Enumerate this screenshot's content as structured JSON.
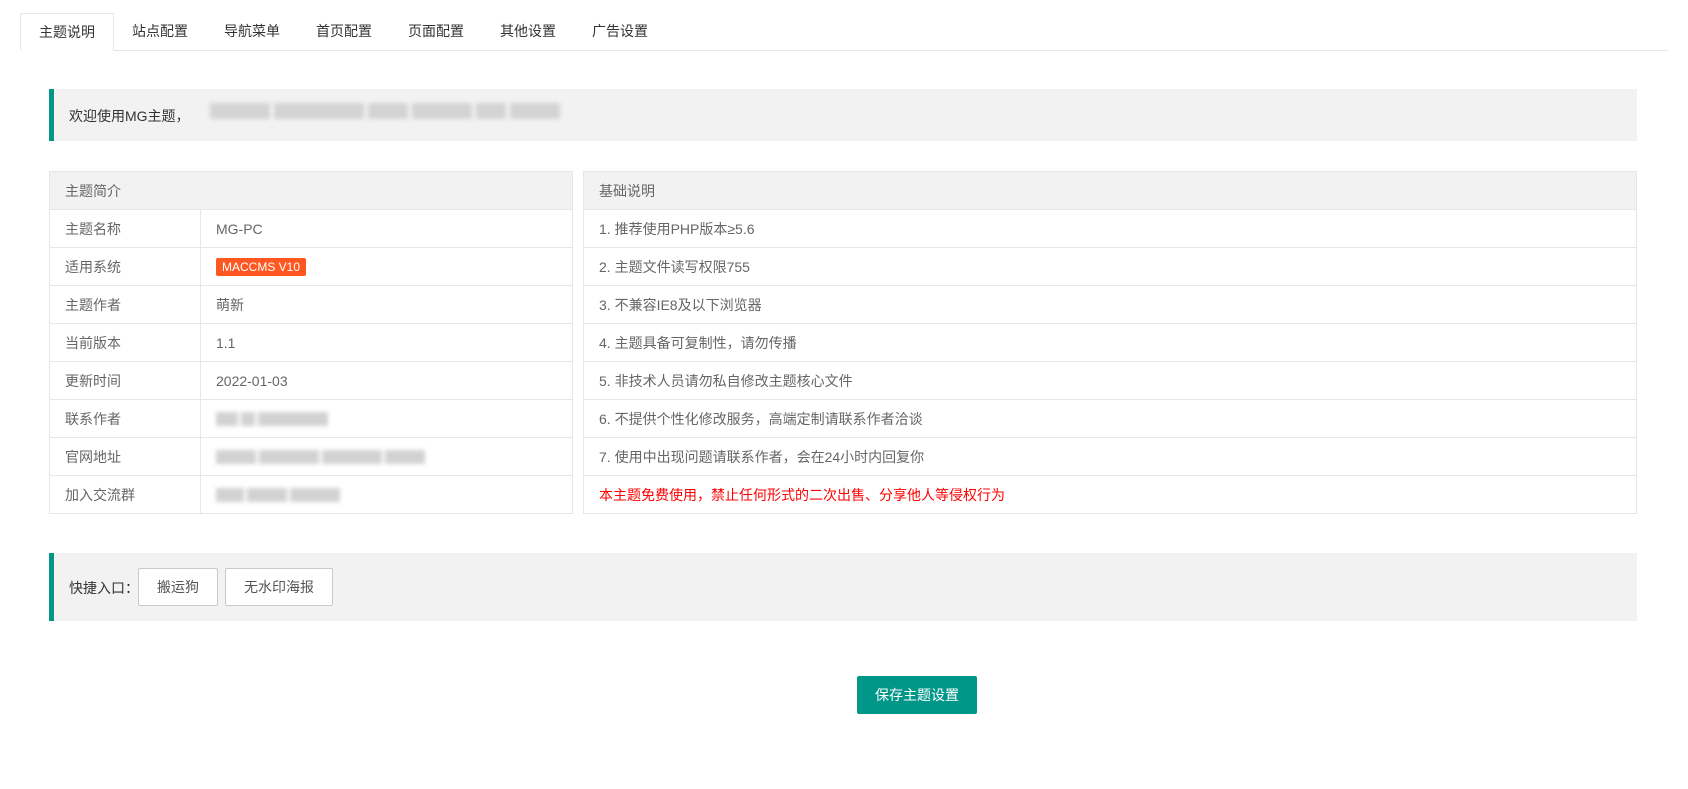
{
  "tabs": [
    {
      "label": "主题说明",
      "active": true
    },
    {
      "label": "站点配置"
    },
    {
      "label": "导航菜单"
    },
    {
      "label": "首页配置"
    },
    {
      "label": "页面配置"
    },
    {
      "label": "其他设置"
    },
    {
      "label": "广告设置"
    }
  ],
  "notice": {
    "text": "欢迎使用MG主题，"
  },
  "intro_table": {
    "header": "主题简介",
    "rows": [
      {
        "key": "主题名称",
        "value": "MG-PC"
      },
      {
        "key": "适用系统",
        "value": "MACCMS V10"
      },
      {
        "key": "主题作者",
        "value": "萌新"
      },
      {
        "key": "当前版本",
        "value": "1.1"
      },
      {
        "key": "更新时间",
        "value": "2022-01-03"
      },
      {
        "key": "联系作者",
        "value": ""
      },
      {
        "key": "官网地址",
        "value": ""
      },
      {
        "key": "加入交流群",
        "value": ""
      }
    ]
  },
  "basic_table": {
    "header": "基础说明",
    "rows": [
      "1. 推荐使用PHP版本≥5.6",
      "2. 主题文件读写权限755",
      "3. 不兼容IE8及以下浏览器",
      "4. 主题具备可复制性，请勿传播",
      "5. 非技术人员请勿私自修改主题核心文件",
      "6. 不提供个性化修改服务，高端定制请联系作者洽谈",
      "7. 使用中出现问题请联系作者，会在24小时内回复你",
      "本主题免费使用，禁止任何形式的二次出售、分享他人等侵权行为"
    ]
  },
  "quick": {
    "label": "快捷入口：",
    "buttons": [
      "搬运狗",
      "无水印海报"
    ]
  },
  "save_label": "保存主题设置",
  "colors": {
    "accent": "#009688",
    "badge": "#ff5722",
    "warning_text": "#ff0000"
  }
}
